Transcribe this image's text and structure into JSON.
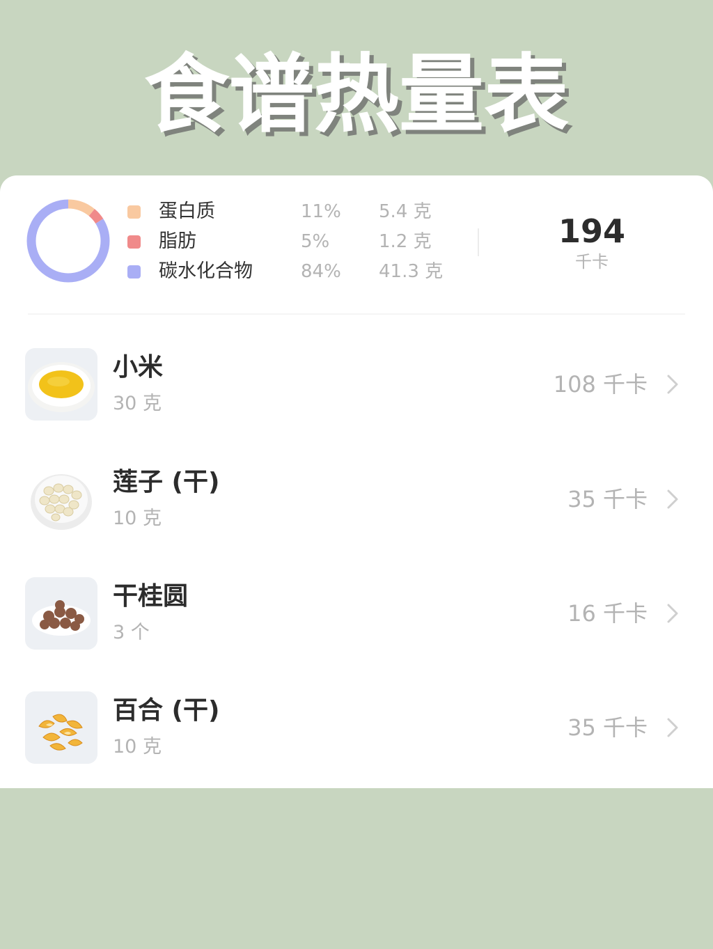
{
  "title": "食谱热量表",
  "summary": {
    "nutrients": [
      {
        "name": "蛋白质",
        "percent": "11%",
        "amount": "5.4 克",
        "color": "#f9c9a0",
        "share": 11
      },
      {
        "name": "脂肪",
        "percent": "5%",
        "amount": "1.2 克",
        "color": "#f08a8a",
        "share": 5
      },
      {
        "name": "碳水化合物",
        "percent": "84%",
        "amount": "41.3 克",
        "color": "#a9aef5",
        "share": 84
      }
    ],
    "total_kcal": "194",
    "total_unit": "千卡"
  },
  "items": [
    {
      "name": "小米",
      "quantity": "30 克",
      "kcal": "108 千卡",
      "icon": "millet-photo"
    },
    {
      "name": "莲子 (干)",
      "quantity": "10 克",
      "kcal": "35 千卡",
      "icon": "lotus-seed-photo"
    },
    {
      "name": "干桂圆",
      "quantity": "3 个",
      "kcal": "16 千卡",
      "icon": "dried-longan-photo"
    },
    {
      "name": "百合 (干)",
      "quantity": "10 克",
      "kcal": "35 千卡",
      "icon": "dried-lily-photo"
    }
  ]
}
